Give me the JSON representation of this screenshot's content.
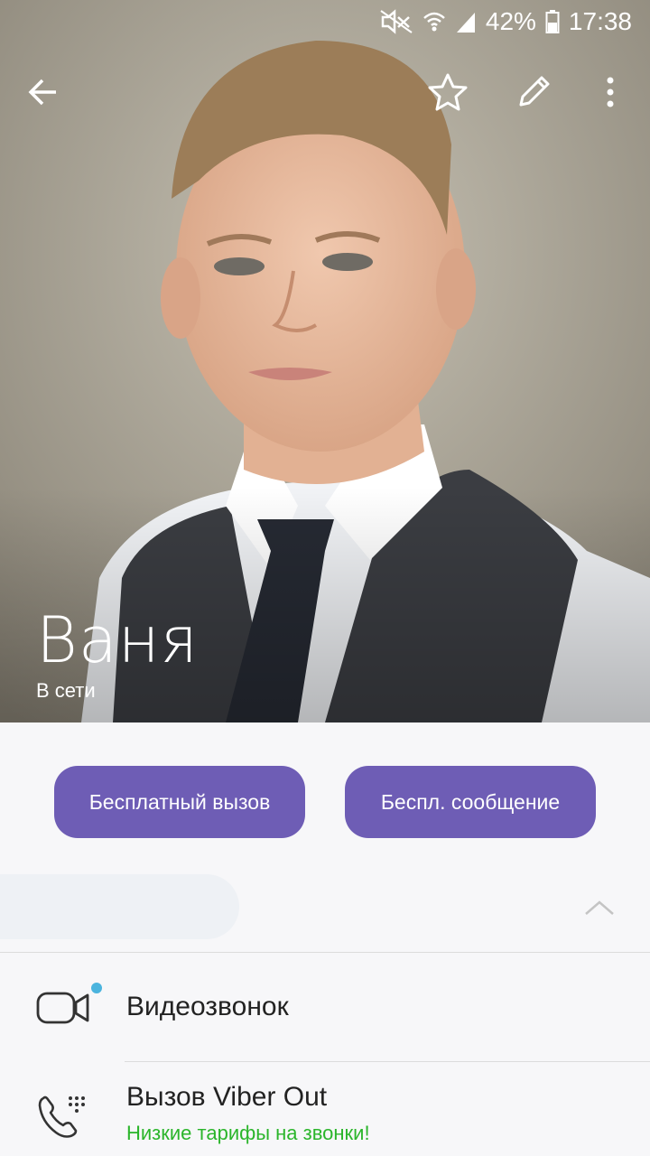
{
  "status_bar": {
    "battery": "42%",
    "time": "17:38",
    "icons": [
      "mute-icon",
      "wifi-icon",
      "signal-icon",
      "battery-icon"
    ]
  },
  "header": {
    "icons": [
      "back-arrow-icon",
      "star-icon",
      "pencil-icon",
      "more-vert-icon"
    ]
  },
  "contact": {
    "name": "Ваня",
    "status": "В сети"
  },
  "actions": {
    "free_call": "Бесплатный вызов",
    "free_message": "Беспл. сообщение"
  },
  "options": [
    {
      "title": "Видеозвонок",
      "subtitle": "",
      "icon": "video-camera-icon"
    },
    {
      "title": "Вызов Viber Out",
      "subtitle": "Низкие тарифы на звонки!",
      "icon": "phone-icon"
    }
  ],
  "colors": {
    "accent": "#6e5db5",
    "promo_green": "#2bb52b",
    "badge_dot": "#4bb4de"
  }
}
